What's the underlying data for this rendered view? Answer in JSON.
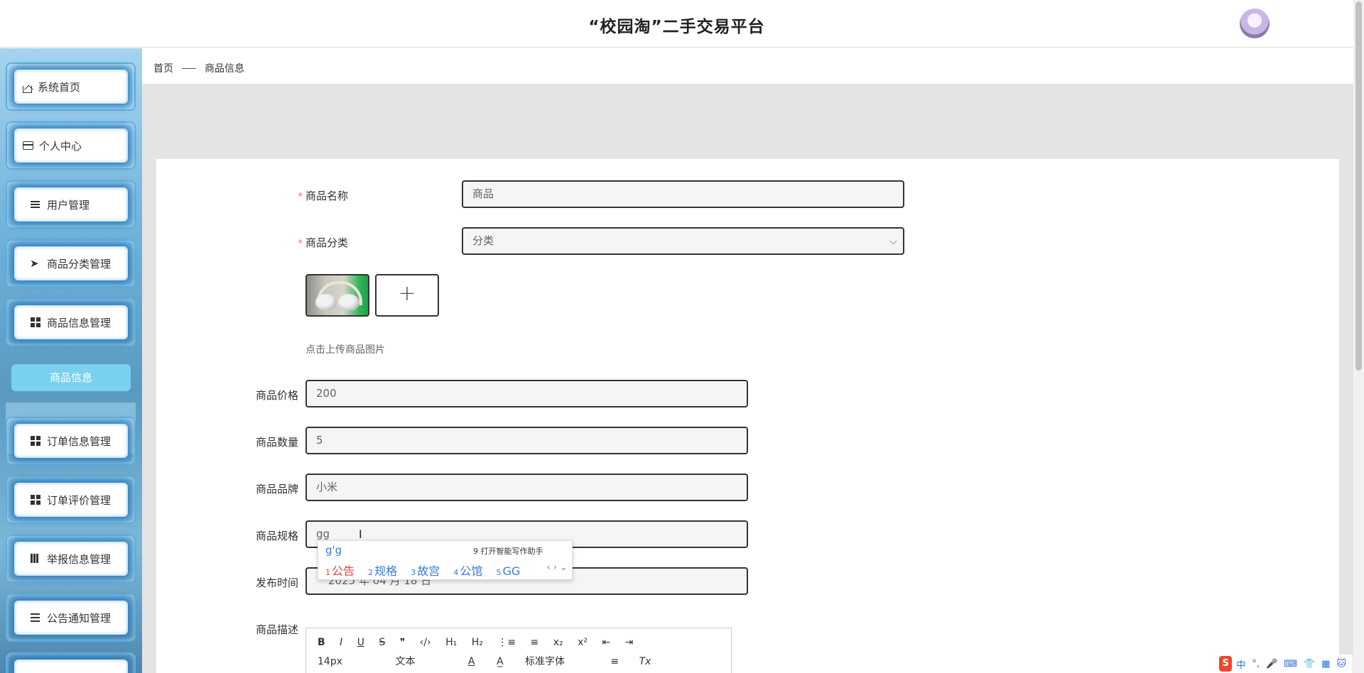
{
  "header": {
    "title": "“校园淘”二手交易平台"
  },
  "sidebar": {
    "items": [
      {
        "label": "系统首页",
        "icon": "home-icon"
      },
      {
        "label": "个人中心",
        "icon": "card-icon"
      },
      {
        "label": "用户管理",
        "icon": "list-icon"
      },
      {
        "label": "商品分类管理",
        "icon": "paper-plane-icon"
      },
      {
        "label": "商品信息管理",
        "icon": "grid-icon"
      },
      {
        "label": "订单信息管理",
        "icon": "grid-icon"
      },
      {
        "label": "订单评价管理",
        "icon": "grid-icon"
      },
      {
        "label": "举报信息管理",
        "icon": "book-icon"
      },
      {
        "label": "公告通知管理",
        "icon": "menu-icon"
      }
    ],
    "sub_item": "商品信息"
  },
  "breadcrumb": {
    "home": "首页",
    "current": "商品信息"
  },
  "form": {
    "name": {
      "label": "商品名称",
      "value": "商品"
    },
    "category": {
      "label": "商品分类",
      "value": "分类"
    },
    "image": {
      "label": "商品图片",
      "hint": "点击上传商品图片",
      "plus": "+"
    },
    "price": {
      "label": "商品价格",
      "value": "200"
    },
    "quantity": {
      "label": "商品数量",
      "value": "5"
    },
    "brand": {
      "label": "商品品牌",
      "value": "小米"
    },
    "spec": {
      "label": "商品规格",
      "value": "gg"
    },
    "publish_time": {
      "label": "发布时间",
      "value": "2025 年 04 月 18 日"
    },
    "description": {
      "label": "商品描述"
    }
  },
  "ime": {
    "composition": "g'g",
    "assist": "9 打开智能写作助手",
    "candidates": [
      {
        "num": "1",
        "text": "公告"
      },
      {
        "num": "2",
        "text": "规格"
      },
      {
        "num": "3",
        "text": "故宫"
      },
      {
        "num": "4",
        "text": "公馆"
      },
      {
        "num": "5",
        "text": "GG"
      }
    ],
    "nav": "‹ › ⌄"
  },
  "editor": {
    "row1": [
      "B",
      "I",
      "U",
      "S",
      "❞",
      "‹/›",
      "H₁",
      "H₂",
      "⋮≡",
      "≡",
      "x₂",
      "x²",
      "⇤",
      "⇥"
    ],
    "size": "14px",
    "type": "文本",
    "font": "标准字体",
    "clear": "Tx"
  },
  "tray": {
    "logo": "S",
    "items": [
      "中",
      "°,",
      "🎤",
      "⌨",
      "👕",
      "▦",
      "🐱"
    ]
  }
}
